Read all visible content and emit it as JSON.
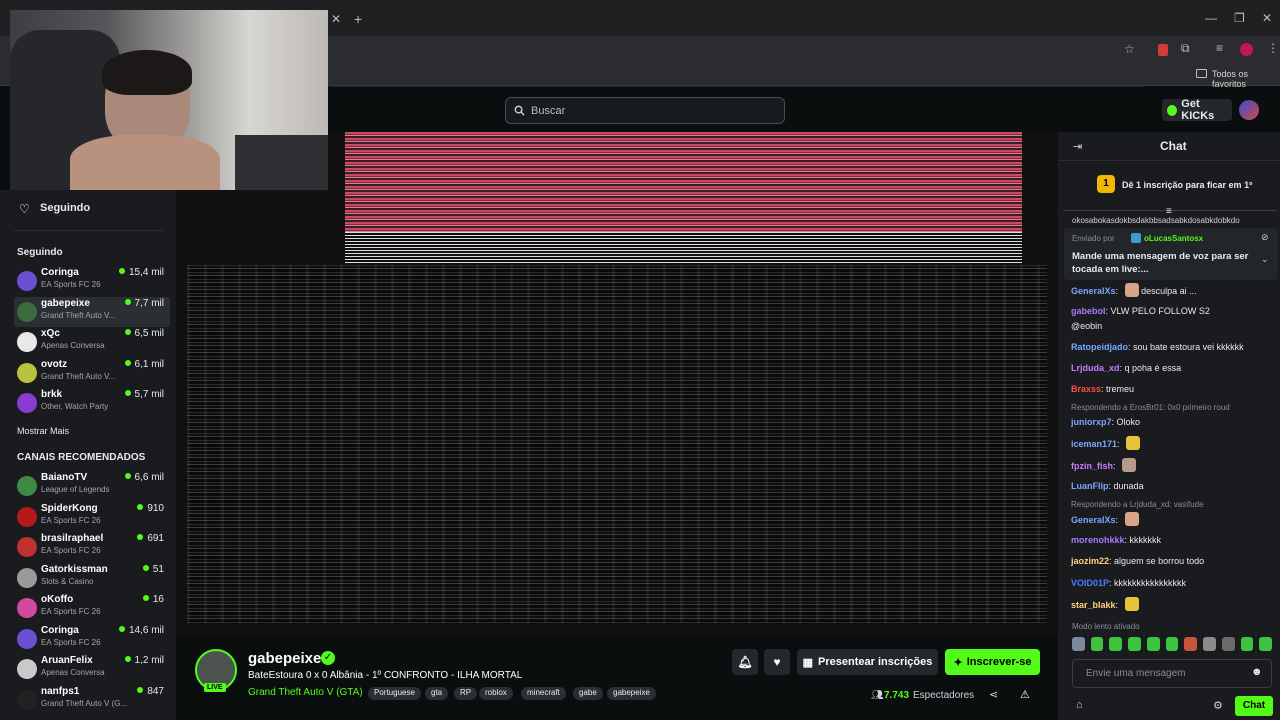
{
  "browser": {
    "bookmarks_label": "Todos os favoritos",
    "window_controls": [
      "—",
      "❐",
      "✕"
    ]
  },
  "top": {
    "search_placeholder": "Buscar",
    "get_kicks": "Get KICKs"
  },
  "sidebar": {
    "following_title": "Seguindo",
    "following_section": "Seguindo",
    "following": [
      {
        "name": "Coringa",
        "game": "EA Sports FC 26",
        "viewers": "15,4 mil",
        "color": "#6b4fd1"
      },
      {
        "name": "gabepeixe",
        "game": "Grand Theft Auto V...",
        "viewers": "7,7 mil",
        "color": "#3a6b3f"
      },
      {
        "name": "xQc",
        "game": "Apenas Conversa",
        "viewers": "6,5 mil",
        "color": "#e8e8e8"
      },
      {
        "name": "ovotz",
        "game": "Grand Theft Auto V...",
        "viewers": "6,1 mil",
        "color": "#b8c23b"
      },
      {
        "name": "brkk",
        "game": "Other, Watch Party",
        "viewers": "5,7 mil",
        "color": "#8a3bd1"
      }
    ],
    "show_more": "Mostrar Mais",
    "recommended_section": "CANAIS RECOMENDADOS",
    "recommended": [
      {
        "name": "BaianoTV",
        "game": "League of Legends",
        "viewers": "6,6 mil",
        "color": "#3e8a44"
      },
      {
        "name": "SpiderKong",
        "game": "EA Sports FC 26",
        "viewers": "910",
        "color": "#b51a1a"
      },
      {
        "name": "brasilraphael",
        "game": "EA Sports FC 26",
        "viewers": "691",
        "color": "#c23030"
      },
      {
        "name": "Gatorkissman",
        "game": "Slots & Casino",
        "viewers": "51",
        "color": "#9a9a9a"
      },
      {
        "name": "oKoffo",
        "game": "EA Sports FC 26",
        "viewers": "16",
        "color": "#d14aa0"
      },
      {
        "name": "Coringa",
        "game": "EA Sports FC 26",
        "viewers": "14,6 mil",
        "color": "#6b4fd1"
      },
      {
        "name": "AruanFelix",
        "game": "Apenas Conversa",
        "viewers": "1,2 mil",
        "color": "#c9c9c9"
      },
      {
        "name": "nanfps1",
        "game": "Grand Theft Auto V (G...",
        "viewers": "847",
        "color": "#222222"
      }
    ]
  },
  "stream": {
    "channel": "gabepeixe",
    "live_badge": "LIVE",
    "title": "BateEstoura 0 x 0 Albânia - 1º CONFRONTO - ILHA MORTAL",
    "category": "Grand Theft Auto V (GTA)",
    "tags": [
      "Portuguese",
      "gta",
      "RP",
      "roblox",
      "minecraft",
      "gabe",
      "gabepeixe"
    ],
    "gift_label": "Presentear inscrições",
    "subscribe_label": "Inscrever-se",
    "viewers": "7.743",
    "viewers_label": "Espectadores"
  },
  "chat": {
    "title": "Chat",
    "pinned_banner": "Dê 1 inscrição para ficar em 1º",
    "pinned_rank": "1",
    "scroll_text": "okosabokasdokbsdakbbsadsabkdosabkdobkdo",
    "sent_by_prefix": "Enviado por",
    "sent_by_user": "oLucasSantosx",
    "voice_message": "Mande uma mensagem de voz para ser tocada em live:...",
    "messages": [
      {
        "user": "GeneralXs",
        "text": "desculpa ai ...",
        "color": "#7aa7ff"
      },
      {
        "user": "gabebol",
        "text": "VLW PELO FOLLOW S2 @eobin",
        "color": "#a77aff"
      },
      {
        "user": "Ratopeidjado",
        "text": "sou bate estoura vei kkkkkk",
        "color": "#7aa7ff"
      },
      {
        "user": "Lrjduda_xd",
        "text": "q poha é essa",
        "color": "#c77aff"
      },
      {
        "user": "Braxss",
        "text": "tremeu",
        "color": "#ff4b4b"
      },
      {
        "user": "juniorxp7",
        "text": "Oloko",
        "color": "#7aa7ff"
      },
      {
        "user": "iceman171",
        "text": "",
        "color": "#7aa7ff"
      },
      {
        "user": "fpzin_fish",
        "text": "",
        "color": "#c77aff"
      },
      {
        "user": "LuanFlip",
        "text": "dunada",
        "color": "#7aa7ff"
      },
      {
        "user": "GeneralXs",
        "text": "",
        "color": "#7aa7ff"
      },
      {
        "user": "morenohkkk",
        "text": "kkkkkkk",
        "color": "#a77aff"
      },
      {
        "user": "jaozim22",
        "text": "alguem se borrou todo",
        "color": "#ffd27a"
      },
      {
        "user": "VOID01P",
        "text": "kkkkkkkkkkkkkkkk",
        "color": "#4b7bff"
      },
      {
        "user": "star_blakk",
        "text": "",
        "color": "#ffd27a"
      }
    ],
    "reply1": "Respondendo a ErosBr01: 0x0 primeiro roud",
    "reply2": "Respondendo a Lrjduda_xd: vasifude",
    "slow_mode": "Modo lento ativado",
    "input_placeholder": "Envie uma mensagem",
    "send_label": "Chat"
  },
  "colors": {
    "accent": "#53fc18",
    "bg": "#0b0e0f",
    "panel": "#191b1f"
  },
  "icons": [
    "heart-icon",
    "search-icon",
    "bell-icon",
    "gift-icon",
    "share-icon",
    "alert-icon",
    "gear-icon",
    "emoji-icon",
    "user-icon"
  ]
}
